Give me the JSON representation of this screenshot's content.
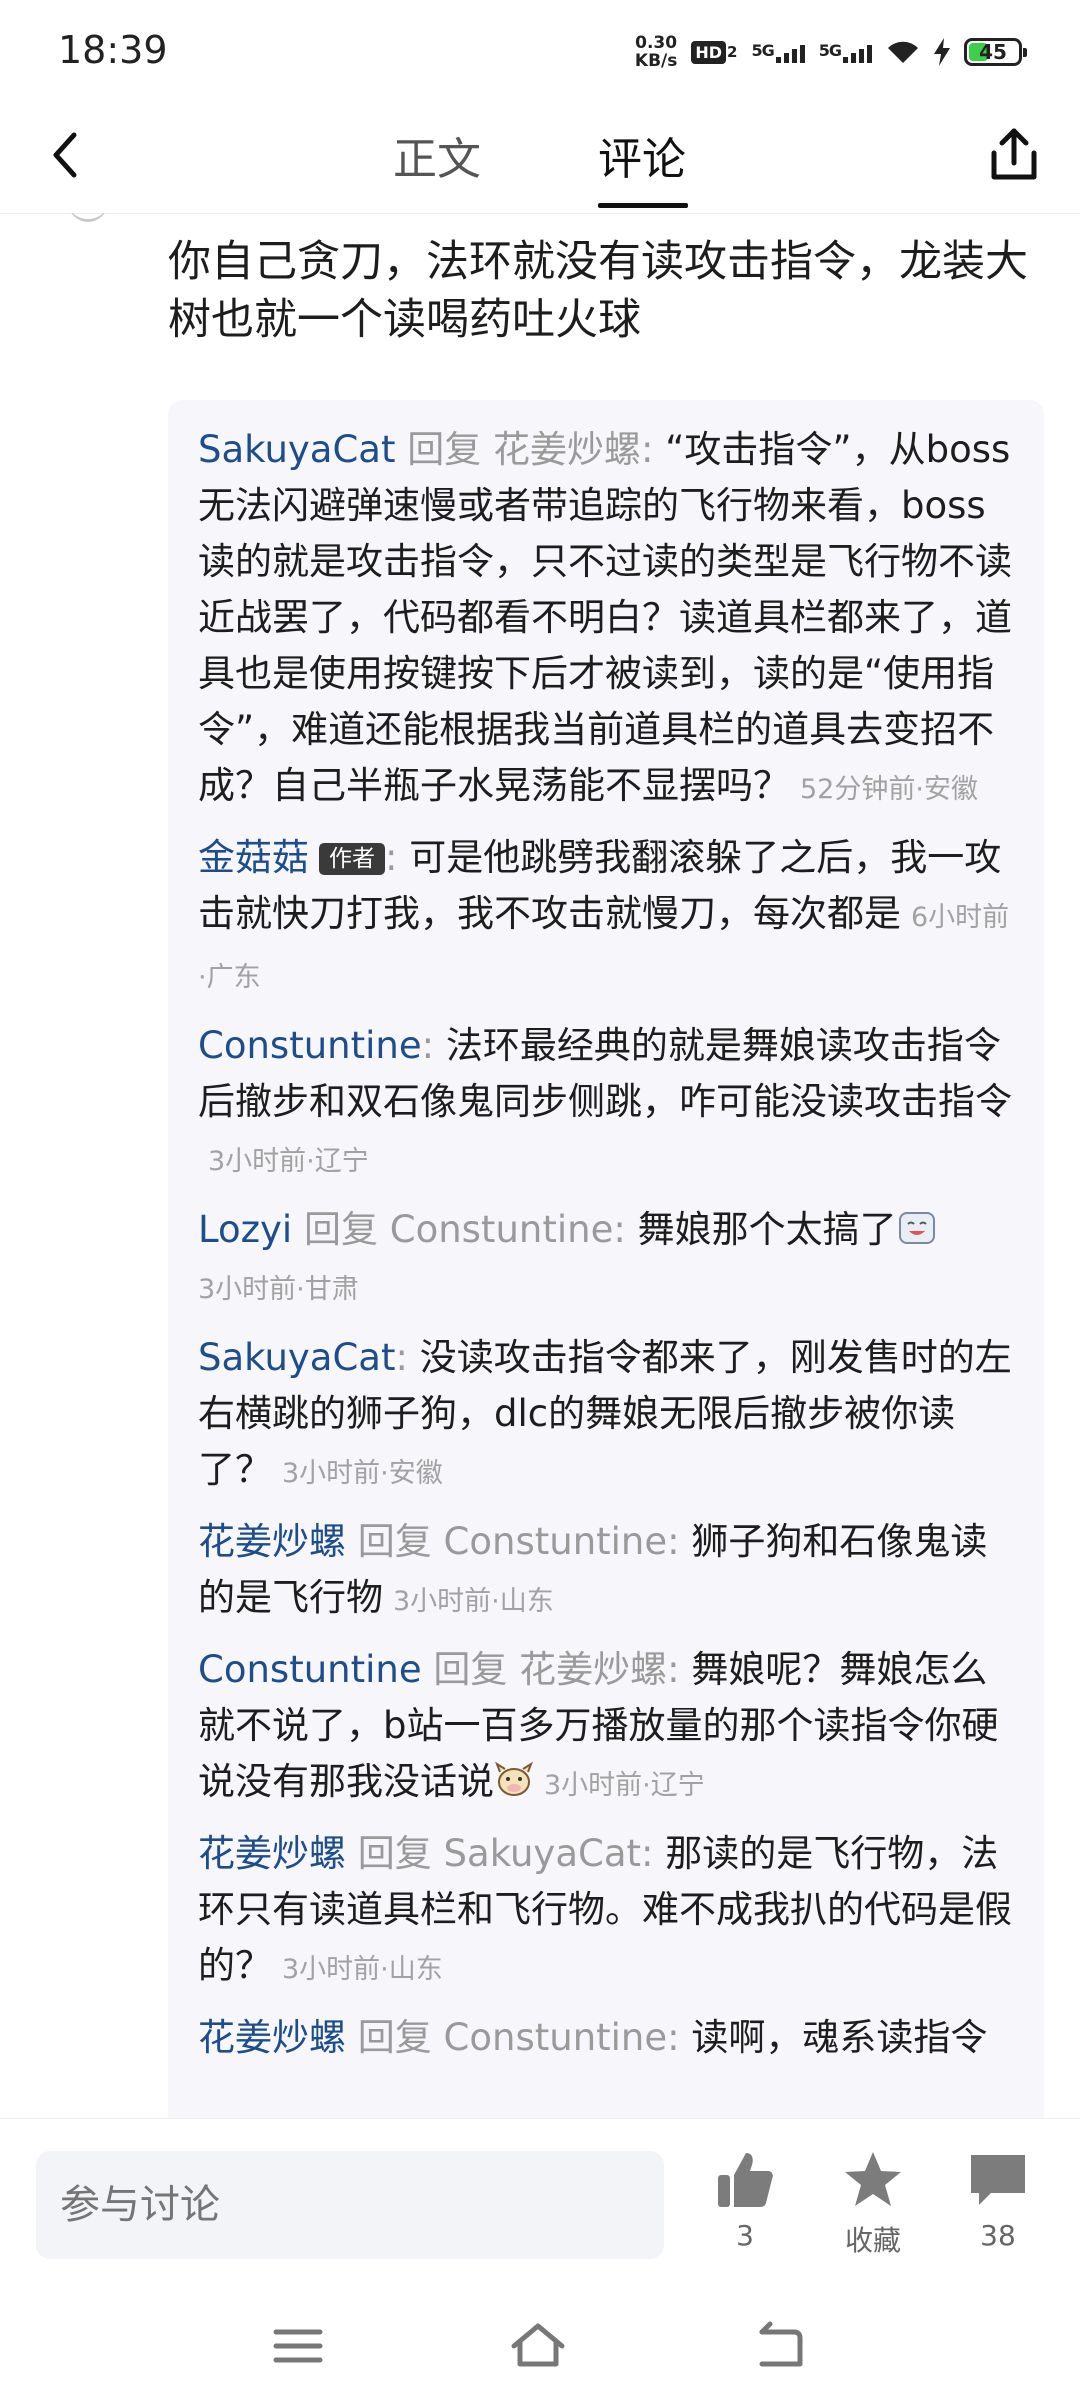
{
  "status_bar": {
    "time": "18:39",
    "net_speed_value": "0.30",
    "net_speed_unit": "KB/s",
    "hd_label": "HD",
    "hd_sub": "2",
    "sig1": "5G",
    "sig2": "5G",
    "battery": "45",
    "battery_level": 0.45
  },
  "nav": {
    "tabs": [
      {
        "label": "正文"
      },
      {
        "label": "评论"
      }
    ],
    "active_tab": "评论"
  },
  "main_comment": {
    "text": "你自己贪刀，法环就没有读攻击指令，龙装大树也就一个读喝药吐火球"
  },
  "replies": [
    {
      "user": "SakuyaCat",
      "reply_word": " 回复 ",
      "reply_to": "花姜炒螺",
      "sep": ": ",
      "text": "“攻击指令”，从boss无法闪避弹速慢或者带追踪的飞行物来看，boss读的就是攻击指令，只不过读的类型是飞行物不读近战罢了，代码都看不明白？读道具栏都来了，道具也是使用按键按下后才被读到，读的是“使用指令”，难道还能根据我当前道具栏的道具去变招不成？自己半瓶子水晃荡能不显摆吗？",
      "meta": "52分钟前·安徽"
    },
    {
      "user": "金菇菇",
      "badge": "作者",
      "sep": ": ",
      "text": "可是他跳劈我翻滚躲了之后，我一攻击就快刀打我，我不攻击就慢刀，每次都是",
      "meta": "6小时前·广东"
    },
    {
      "user": "Constuntine",
      "sep": ": ",
      "text": "法环最经典的就是舞娘读攻击指令后撤步和双石像鬼同步侧跳，咋可能没读攻击指令",
      "meta": "3小时前·辽宁"
    },
    {
      "user": "Lozyi",
      "reply_word": " 回复 ",
      "reply_to": "Constuntine",
      "sep": ": ",
      "text": "舞娘那个太搞了",
      "emoji": "laugh-emoji",
      "meta": "3小时前·甘肃"
    },
    {
      "user": "SakuyaCat",
      "sep": ": ",
      "text": "没读攻击指令都来了，刚发售时的左右横跳的狮子狗，dlc的舞娘无限后撤步被你读了？",
      "meta": "3小时前·安徽"
    },
    {
      "user": "花姜炒螺",
      "reply_word": " 回复 ",
      "reply_to": "Constuntine",
      "sep": ": ",
      "text": "狮子狗和石像鬼读的是飞行物",
      "meta": "3小时前·山东"
    },
    {
      "user": "Constuntine",
      "reply_word": " 回复 ",
      "reply_to": "花姜炒螺",
      "sep": ": ",
      "text": "舞娘呢？舞娘怎么就不说了，b站一百多万播放量的那个读指令你硬说没有那我没话说",
      "emoji": "cow-emoji",
      "meta": "3小时前·辽宁"
    },
    {
      "user": "花姜炒螺",
      "reply_word": " 回复 ",
      "reply_to": "SakuyaCat",
      "sep": ": ",
      "text": "那读的是飞行物，法环只有读道具栏和飞行物。难不成我扒的代码是假的？",
      "meta": "3小时前·山东"
    },
    {
      "user": "花姜炒螺",
      "reply_word": " 回复 ",
      "reply_to": "Constuntine",
      "sep": ": ",
      "text": "读啊，魂系读指令",
      "meta": ""
    }
  ],
  "action_bar": {
    "input_placeholder": "参与讨论",
    "like_count": "3",
    "favorite_label": "收藏",
    "comment_count": "38"
  },
  "icons": [
    "back-arrow-icon",
    "share-icon",
    "thumbs-up-icon",
    "star-icon",
    "comment-bubble-icon",
    "menu-icon",
    "home-icon",
    "back-gesture-icon"
  ]
}
